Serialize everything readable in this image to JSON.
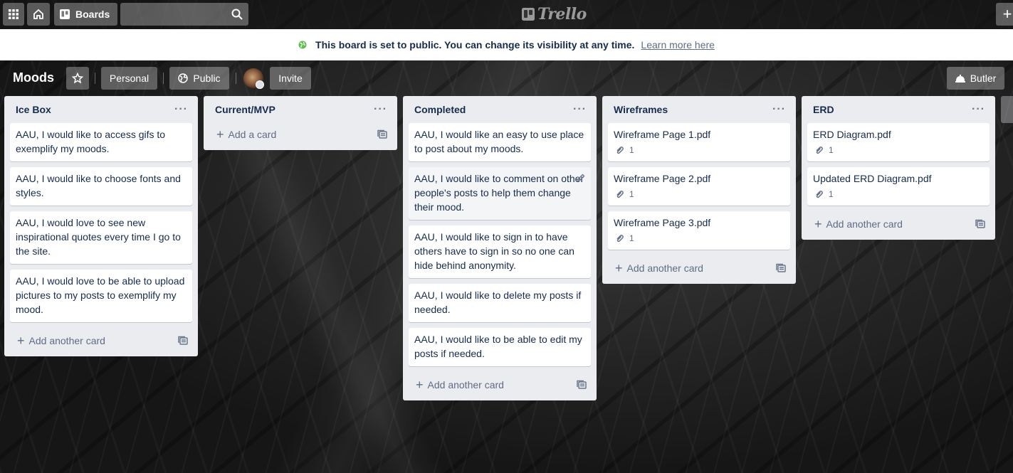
{
  "nav": {
    "boards_label": "Boards",
    "search_placeholder": "",
    "logo_text": "Trello"
  },
  "banner": {
    "text": "This board is set to public. You can change its visibility at any time.",
    "link": "Learn more here"
  },
  "board": {
    "title": "Moods",
    "personal_label": "Personal",
    "public_label": "Public",
    "invite_label": "Invite",
    "butler_label": "Butler"
  },
  "lists": [
    {
      "title": "Ice Box",
      "cards": [
        {
          "text": "AAU, I would like to access gifs to exemplify my moods."
        },
        {
          "text": "AAU, I would like to choose fonts and styles."
        },
        {
          "text": "AAU, I would love to see new inspirational quotes every time I go to the site."
        },
        {
          "text": "AAU, I would love to be able to upload pictures to my posts to exemplify my mood."
        }
      ],
      "add_label": "Add another card"
    },
    {
      "title": "Current/MVP",
      "cards": [],
      "add_label": "Add a card"
    },
    {
      "title": "Completed",
      "cards": [
        {
          "text": "AAU, I would like an easy to use place to post about my moods."
        },
        {
          "text": "AAU, I would like to comment on other people's posts to help them change their mood."
        },
        {
          "text": "AAU, I would like to sign in to have others have to sign in so no one can hide behind anonymity."
        },
        {
          "text": "AAU, I would like to delete my posts if needed."
        },
        {
          "text": "AAU, I would like to be able to edit my posts if needed."
        }
      ],
      "add_label": "Add another card"
    },
    {
      "title": "Wireframes",
      "cards": [
        {
          "text": "Wireframe Page 1.pdf",
          "attachments": "1"
        },
        {
          "text": "Wireframe Page 2.pdf",
          "attachments": "1"
        },
        {
          "text": "Wireframe Page 3.pdf",
          "attachments": "1"
        }
      ],
      "add_label": "Add another card"
    },
    {
      "title": "ERD",
      "cards": [
        {
          "text": "ERD Diagram.pdf",
          "attachments": "1"
        },
        {
          "text": "Updated ERD Diagram.pdf",
          "attachments": "1"
        }
      ],
      "add_label": "Add another card"
    }
  ],
  "icons": {
    "apps": "grid-icon",
    "home": "home-icon",
    "boards": "board-icon",
    "search": "search-icon",
    "star": "star-icon",
    "globe": "globe-icon",
    "attachment": "paperclip-icon",
    "template": "template-icon",
    "edit": "pencil-icon"
  },
  "colors": {
    "list_bg": "#ebecf0",
    "card_text": "#172b4d",
    "muted_text": "#5e6c84",
    "banner_globe": "#61bd4f"
  }
}
